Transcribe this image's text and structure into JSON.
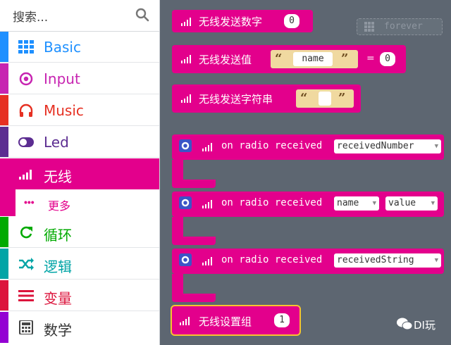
{
  "search": {
    "placeholder": "搜索..."
  },
  "categories": [
    {
      "label": "Basic",
      "color": "#1e90ff",
      "icon": "grid-icon"
    },
    {
      "label": "Input",
      "color": "#c724b1",
      "icon": "target-icon"
    },
    {
      "label": "Music",
      "color": "#e63022",
      "icon": "headphones-icon"
    },
    {
      "label": "Led",
      "color": "#5c2d91",
      "icon": "toggle-icon"
    },
    {
      "label": "无线",
      "color": "#e3008c",
      "icon": "signal-icon"
    },
    {
      "label": "循环",
      "color": "#00aa00",
      "icon": "refresh-icon"
    },
    {
      "label": "逻辑",
      "color": "#00a4a6",
      "icon": "shuffle-icon"
    },
    {
      "label": "变量",
      "color": "#dc143c",
      "icon": "list-icon"
    },
    {
      "label": "数学",
      "color": "#9400d3",
      "icon": "calculator-icon"
    }
  ],
  "sub_item": {
    "label": "更多",
    "dots": "•••"
  },
  "blocks": {
    "send_number": {
      "label": "无线发送数字",
      "value": "0"
    },
    "send_value": {
      "label": "无线发送值",
      "name": "name",
      "equals": "=",
      "value": "0"
    },
    "send_string": {
      "label": "无线发送字符串"
    },
    "recv_number": {
      "label": "on radio received",
      "param": "receivedNumber"
    },
    "recv_value": {
      "label": "on radio received",
      "param1": "name",
      "param2": "value"
    },
    "recv_string": {
      "label": "on radio received",
      "param": "receivedString"
    },
    "set_group": {
      "label": "无线设置组",
      "value": "1"
    }
  },
  "ghost_block": {
    "label": "forever"
  },
  "watermark": {
    "text": "DI玩"
  },
  "colors": {
    "radio": "#e3008c",
    "workspace": "#5d6671",
    "highlight": "#f7c230"
  }
}
